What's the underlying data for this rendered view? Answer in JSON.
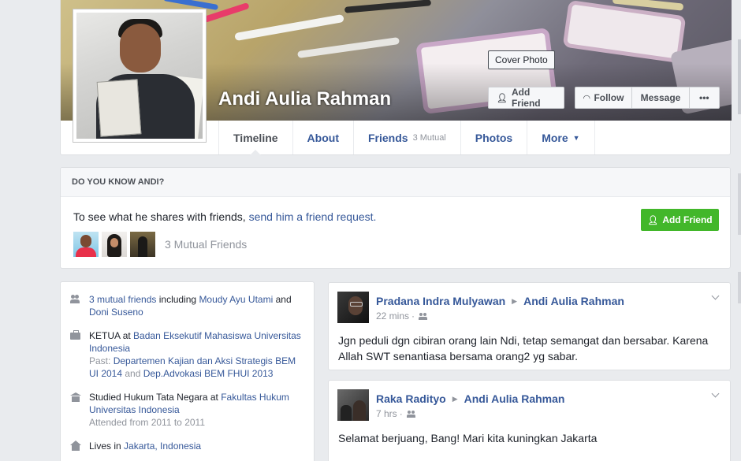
{
  "profile": {
    "name": "Andi Aulia Rahman",
    "cover_photo_label": "Cover Photo",
    "add_friend_label": "Add Friend",
    "follow_label": "Follow",
    "message_label": "Message",
    "more_options_label": "•••"
  },
  "tabs": [
    {
      "label": "Timeline",
      "sub": ""
    },
    {
      "label": "About",
      "sub": ""
    },
    {
      "label": "Friends",
      "sub": "3 Mutual"
    },
    {
      "label": "Photos",
      "sub": ""
    },
    {
      "label": "More",
      "sub": ""
    }
  ],
  "know_box": {
    "heading": "DO YOU KNOW ANDI?",
    "text_prefix": "To see what he shares with friends, ",
    "text_link": "send him a friend request.",
    "add_friend_label": "Add Friend",
    "mutual_count": "3 Mutual Friends"
  },
  "intro": {
    "friends": {
      "link1": "3 mutual friends",
      "mid": " including ",
      "link2": "Moudy Ayu Utami",
      "and": " and ",
      "link3": "Doni Suseno"
    },
    "work": {
      "role": "KETUA",
      "at": " at ",
      "org": "Badan Eksekutif Mahasiswa Universitas Indonesia",
      "past_label": "Past: ",
      "past1": "Departemen Kajian dan Aksi Strategis BEM UI 2014",
      "past_and": " and ",
      "past2": "Dep.Advokasi BEM FHUI 2013"
    },
    "education": {
      "prefix": "Studied Hukum Tata Negara at ",
      "school": "Fakultas Hukum Universitas Indonesia",
      "attended": "Attended from 2011 to 2011"
    },
    "lives": {
      "prefix": "Lives in ",
      "city": "Jakarta, Indonesia"
    }
  },
  "posts": [
    {
      "author": "Pradana Indra Mulyawan",
      "target": "Andi Aulia Rahman",
      "time": "22 mins",
      "text": "Jgn peduli dgn cibiran orang lain Ndi, tetap semangat dan bersabar. Karena Allah SWT senantiasa bersama orang2 yg sabar."
    },
    {
      "author": "Raka Radityo",
      "target": "Andi Aulia Rahman",
      "time": "7 hrs",
      "text": "Selamat berjuang, Bang! Mari kita kuningkan Jakarta"
    }
  ],
  "icons": {
    "add_friend": "add-friend-icon",
    "follow": "rss-icon",
    "caret": "caret-down-icon",
    "audience": "friends-audience-icon"
  },
  "colors": {
    "link": "#365899",
    "green_button": "#42b72a",
    "background": "#e9ebee",
    "muted": "#90949c"
  }
}
